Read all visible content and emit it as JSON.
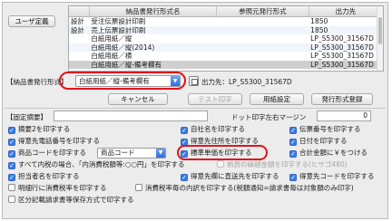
{
  "header": {
    "user_def_button": "ユーザ定義"
  },
  "table": {
    "columns": [
      "納品書発行形式名",
      "参照元発行形式",
      "出力先"
    ],
    "rows": [
      {
        "c0": "設計",
        "c1": "受注伝票設計印刷",
        "c2": "",
        "c3": "1850"
      },
      {
        "c0": "設計",
        "c1": "売上伝票設計印刷",
        "c2": "",
        "c3": "1850"
      },
      {
        "c0": "",
        "c1": "白紙用紙／縦",
        "c2": "",
        "c3": "LP_S5300_31567D"
      },
      {
        "c0": "",
        "c1": "白紙用紙／縦(2014)",
        "c2": "",
        "c3": "LP_S5300_31567D"
      },
      {
        "c0": "",
        "c1": "白紙用紙／横",
        "c2": "",
        "c3": "LP_S5300_31567D"
      },
      {
        "c0": "",
        "c1": "白紙用紙／縦-備考欄有",
        "c2": "",
        "c3": "LP_S5300_31567D"
      }
    ]
  },
  "format_row": {
    "label": "【納品書発行形式】",
    "selected": "白紙用紙／縦-備考欄有",
    "output_label": "出力先：LP_S5300_31567D"
  },
  "actions": {
    "cancel": "キャンセル",
    "test_print": "テスト印字",
    "user_config": "用紙設定",
    "register": "発行形式登録"
  },
  "fixed": {
    "label": "【固定摘要】",
    "value": "",
    "dot_label": "ドット印字左右マージン",
    "dot_value": "0"
  },
  "options": {
    "o1": {
      "label": "摘要2を印字する",
      "checked": true
    },
    "o2": {
      "label": "自社名を印字する",
      "checked": true
    },
    "o3": {
      "label": "伝票番号を印字する",
      "checked": true
    },
    "o4": {
      "label": "得意先電話番号を印字する",
      "checked": true
    },
    "o5": {
      "label": "得意先住所を印字する",
      "checked": true
    },
    "o6": {
      "label": "日付を印字する",
      "checked": true
    },
    "o7": {
      "label": "商品コードを印字する",
      "checked": true
    },
    "o7_select": "商品コード",
    "o8": {
      "label": "標準単価を印字する",
      "checked": true
    },
    "o9": {
      "label": "合計金額に￥をつける",
      "checked": true
    },
    "o10": {
      "label": "すべて内税の場合、「内消費税額等:○○円」を印字する",
      "checked": true
    },
    "o11": {
      "label": "前頁の繰越金額を印字する(ヒサゴ480)",
      "checked": false,
      "disabled": true
    },
    "o12": {
      "label": "担当者名を印字する",
      "checked": true
    },
    "o13": {
      "label": "得意先欄に直送先を印字する",
      "checked": true
    },
    "o14": {
      "label": "得意先コードを印字する",
      "checked": true
    },
    "o15": {
      "label": "明細行に消費税率を印字する",
      "checked": false
    },
    "o16": {
      "label": "消費税率毎の内訳を印字する(税額通知=請求書毎は対象額のみ印字)",
      "checked": false
    },
    "o17": {
      "label": "区分記載請求書等保存方式で印字する",
      "checked": false
    }
  },
  "colors": {
    "checkbox_on": "#3b7de4",
    "highlight": "#e0141b"
  }
}
